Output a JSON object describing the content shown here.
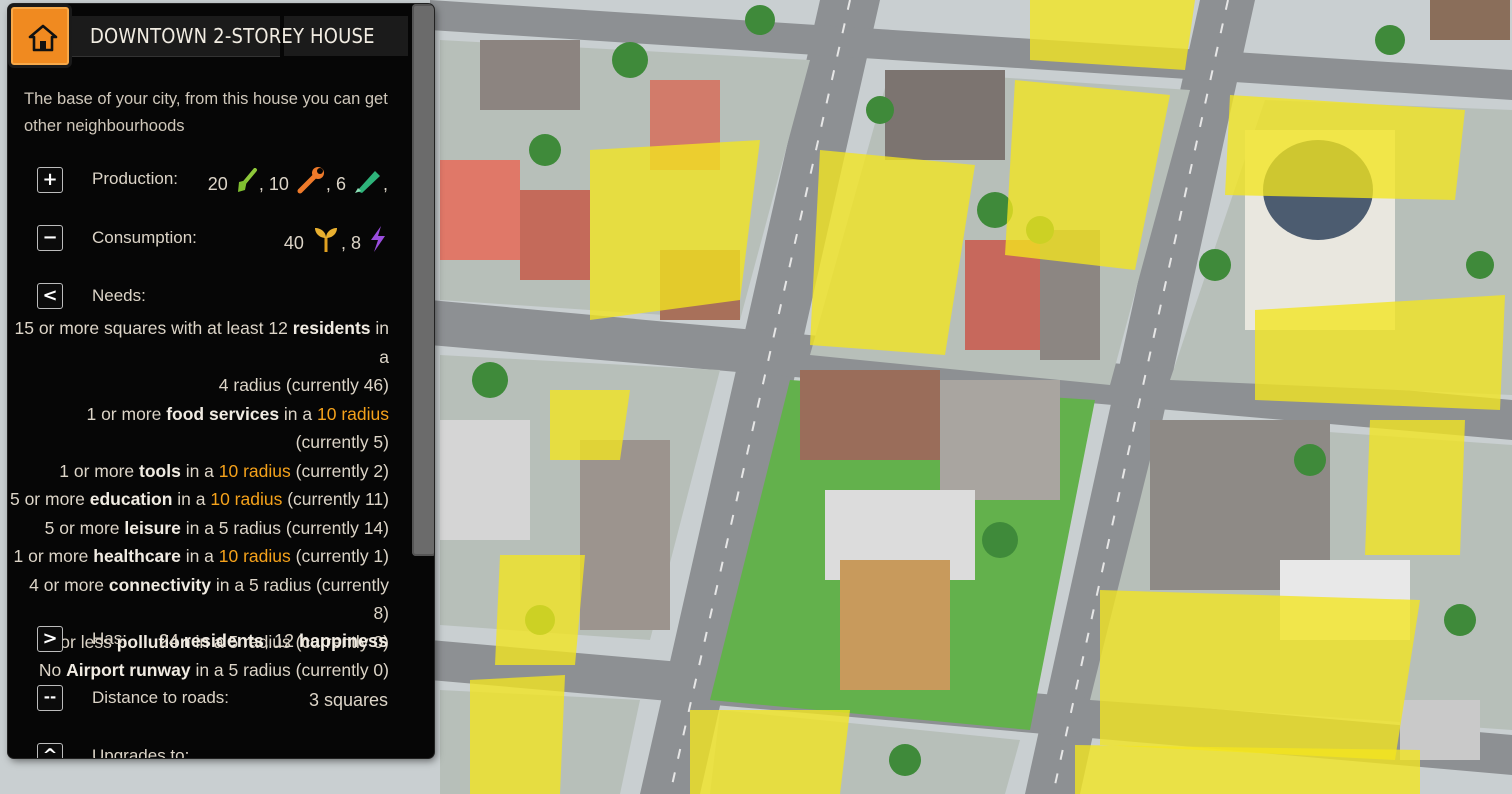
{
  "colors": {
    "accent": "#f08a20",
    "highlight_orange": "#f5a21b",
    "zone_yellow": "#f3e61f",
    "panel_bg": "#060606"
  },
  "panel": {
    "home_icon": "home-icon",
    "title": "DOWNTOWN 2-STOREY HOUSE",
    "description": "The base of your city, from this house you can get other neighbourhoods",
    "production": {
      "label": "Production:",
      "items": [
        {
          "value": "20",
          "icon": "shovel-icon",
          "sep": ","
        },
        {
          "value": "10",
          "icon": "wrench-icon",
          "sep": ","
        },
        {
          "value": "6",
          "icon": "pen-icon",
          "sep": ","
        }
      ]
    },
    "consumption": {
      "label": "Consumption:",
      "items": [
        {
          "value": "40",
          "icon": "sprout-icon",
          "sep": ","
        },
        {
          "value": "8",
          "icon": "lightning-icon",
          "sep": ""
        }
      ]
    },
    "needs": {
      "label": "Needs:",
      "line1a": "15 or more squares with at least 12 ",
      "line1b": "residents",
      "line1c": " in a",
      "line2": "4 radius (currently 46)",
      "food": {
        "pre": "1 or more ",
        "key": "food services",
        "mid": " in a ",
        "radius": "10 radius",
        "post": " (currently 5)"
      },
      "tools": {
        "pre": "1 or more ",
        "key": "tools",
        "mid": " in a ",
        "radius": "10 radius",
        "post": " (currently 2)"
      },
      "education": {
        "pre": "5 or more ",
        "key": "education",
        "mid": " in a ",
        "radius": "10 radius",
        "post": " (currently 11)"
      },
      "leisure": {
        "pre": "5 or more ",
        "key": "leisure",
        "post": " in a 5 radius (currently 14)"
      },
      "healthcare": {
        "pre": "1 or more ",
        "key": "healthcare",
        "mid": " in a ",
        "radius": "10 radius",
        "post": " (currently 1)"
      },
      "connectivity": {
        "pre": "4 or more ",
        "key": "connectivity",
        "post": " in a 5 radius (currently 8)"
      },
      "pollution": {
        "pre": "0 or less ",
        "key": "pollution",
        "post": " in a 5 radius (currently 0)"
      },
      "airport": {
        "pre": "No ",
        "key": "Airport runway",
        "post": " in a 5 radius (currently 0)"
      }
    },
    "has": {
      "label": "Has:",
      "v1": "24 ",
      "k1": "residents",
      "v2": ", 12 ",
      "k2": "happiness"
    },
    "distance": {
      "label": "Distance to roads:",
      "value": "3 squares"
    },
    "upgrades": {
      "label": "Upgrades to:"
    },
    "buttons": {
      "production": "+",
      "consumption": "−",
      "needs": "<",
      "has": ">",
      "distance": "--",
      "upgrades": "^"
    }
  }
}
